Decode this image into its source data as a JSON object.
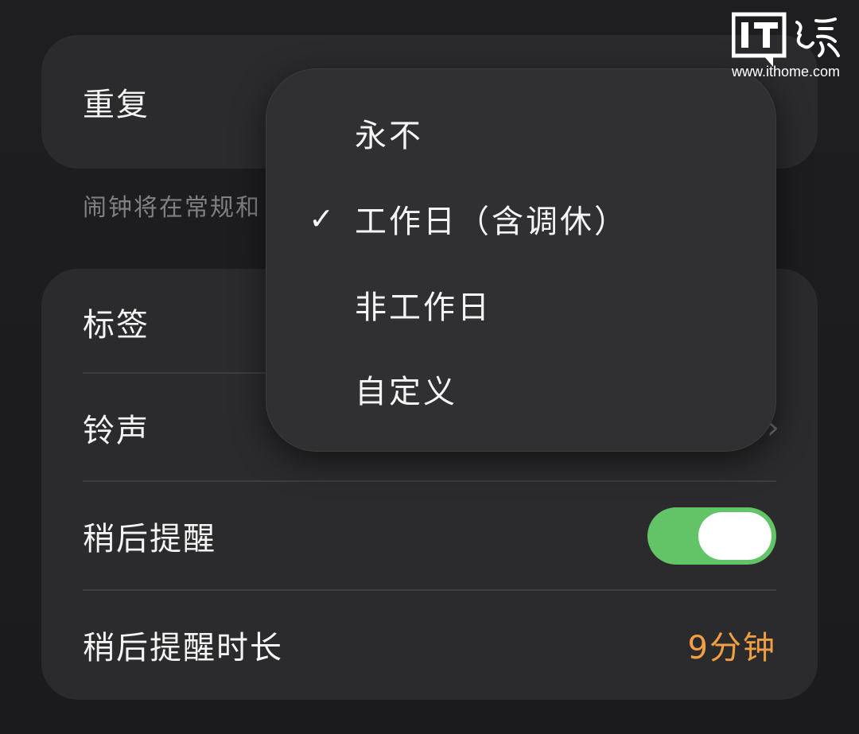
{
  "repeat_card": {
    "label": "重复"
  },
  "footnote": "闹钟将在常规和",
  "settings": {
    "rows": [
      {
        "label": "标签"
      },
      {
        "label": "铃声"
      },
      {
        "label": "稍后提醒",
        "toggle_on": true
      },
      {
        "label": "稍后提醒时长",
        "value": "9分钟"
      }
    ]
  },
  "repeat_menu": {
    "items": [
      {
        "label": "永不",
        "checked": false
      },
      {
        "label": "工作日（含调休）",
        "checked": true
      },
      {
        "label": "非工作日",
        "checked": false
      },
      {
        "label": "自定义",
        "checked": false
      }
    ],
    "check_glyph": "✓"
  },
  "watermark": {
    "brand": "IT之家",
    "url": "www.ithome.com"
  },
  "colors": {
    "background": "#1c1c1e",
    "card": "#2b2b2d",
    "menu": "#303033",
    "accent_value": "#f0a043",
    "toggle_on": "#62c466",
    "secondary_text": "#7f7f84"
  },
  "icons": {
    "chevron": "chevron-right-icon",
    "check": "checkmark-icon"
  }
}
